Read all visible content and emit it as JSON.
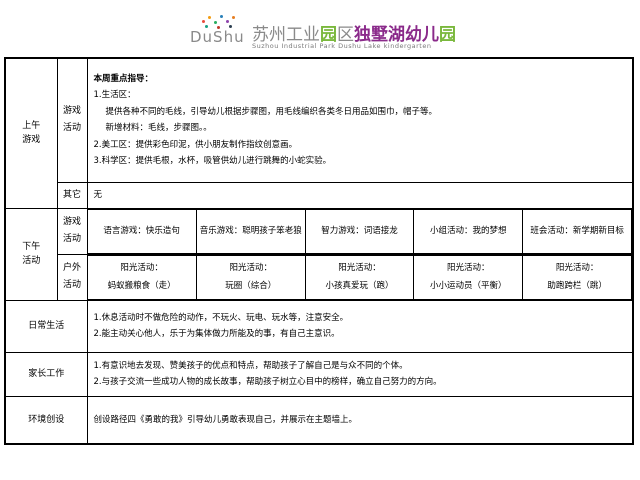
{
  "header": {
    "logo_mark": "DuShu",
    "title_parts": [
      "苏州工业",
      "园",
      "区",
      "独",
      "墅",
      "湖",
      "幼儿",
      "园"
    ],
    "subtitle": "Suzhou Industrial Park Dushu Lake kindergarten"
  },
  "morning": {
    "label_line1": "上午",
    "label_line2": "游戏",
    "game_label_line1": "游戏",
    "game_label_line2": "活动",
    "guidance_title": "本周重点指导：",
    "lines": [
      "1.生活区：",
      "提供各种不同的毛线，引导幼儿根据步骤图，用毛线编织各类冬日用品如围巾，帽子等。",
      "新增材料：毛线，步骤图。。",
      "2.美工区：提供彩色印泥，供小朋友制作指纹创意画。",
      "3.科学区：提供毛根，水杯，吸管供幼儿进行跳舞的小蛇实验。"
    ],
    "other_label": "其它",
    "other_value": "无"
  },
  "afternoon": {
    "label_line1": "下午",
    "label_line2": "活动",
    "game_label_line1": "游戏",
    "game_label_line2": "活动",
    "games": [
      "语言游戏：快乐造句",
      "音乐游戏：聪明孩子笨老狼",
      "智力游戏：词语接龙",
      "小组活动：我的梦想",
      "班会活动：新学期新目标"
    ],
    "outdoor_label_line1": "户外",
    "outdoor_label_line2": "活动",
    "outdoor": [
      {
        "title": "阳光活动：",
        "item": "蚂蚁搬粮食（走）"
      },
      {
        "title": "阳光活动：",
        "item": "玩圈（综合）"
      },
      {
        "title": "阳光活动：",
        "item": "小孩真爱玩（跑）"
      },
      {
        "title": "阳光活动：",
        "item": "小小运动员（平衡）"
      },
      {
        "title": "阳光活动：",
        "item": "助跑跨栏（跳）"
      }
    ]
  },
  "daily": {
    "label": "日常生活",
    "lines": [
      "1.休息活动时不做危险的动作，不玩火、玩电、玩水等，注意安全。",
      "2.能主动关心他人，乐于为集体做力所能及的事，有自己主意识。"
    ]
  },
  "parents": {
    "label": "家长工作",
    "lines": [
      "1.有意识地去发现、赞美孩子的优点和特点，帮助孩子了解自己是与众不同的个体。",
      "2.与孩子交流一些成功人物的成长故事，帮助孩子树立心目中的榜样，确立自己努力的方向。"
    ]
  },
  "environment": {
    "label": "环境创设",
    "text": "创设路径四《勇敢的我》引导幼儿勇敢表现自己，并展示在主题墙上。"
  },
  "colors": {
    "title_grey": "#8a8a8a",
    "title_green": "#7ab83c",
    "title_purple": "#8a2a8a"
  }
}
